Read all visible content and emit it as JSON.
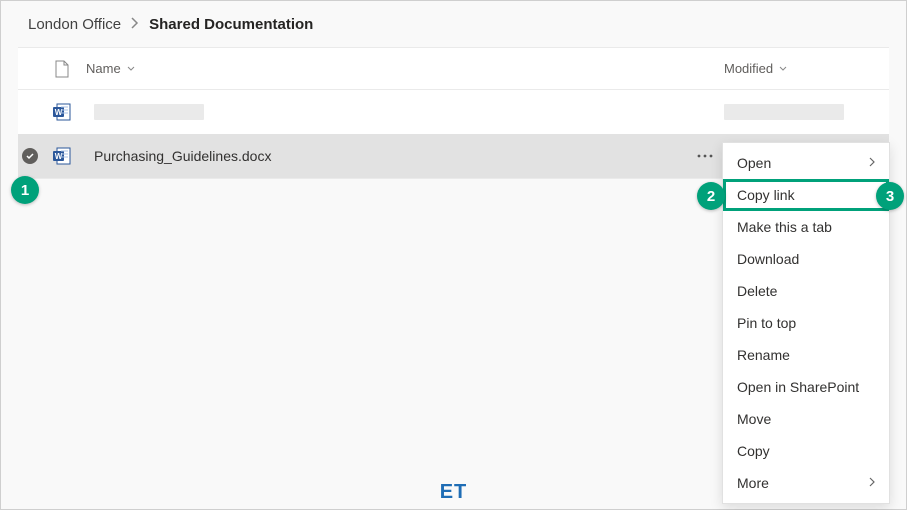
{
  "breadcrumb": {
    "parent": "London Office",
    "current": "Shared Documentation"
  },
  "columns": {
    "name": "Name",
    "modified": "Modified"
  },
  "rows": [
    {
      "name": "",
      "selected": false,
      "redacted": true
    },
    {
      "name": "Purchasing_Guidelines.docx",
      "selected": true,
      "redacted": false
    }
  ],
  "menu": {
    "items": [
      {
        "label": "Open",
        "submenu": true,
        "highlighted": false
      },
      {
        "label": "Copy link",
        "submenu": false,
        "highlighted": true
      },
      {
        "label": "Make this a tab",
        "submenu": false,
        "highlighted": false
      },
      {
        "label": "Download",
        "submenu": false,
        "highlighted": false
      },
      {
        "label": "Delete",
        "submenu": false,
        "highlighted": false
      },
      {
        "label": "Pin to top",
        "submenu": false,
        "highlighted": false
      },
      {
        "label": "Rename",
        "submenu": false,
        "highlighted": false
      },
      {
        "label": "Open in SharePoint",
        "submenu": false,
        "highlighted": false
      },
      {
        "label": "Move",
        "submenu": false,
        "highlighted": false
      },
      {
        "label": "Copy",
        "submenu": false,
        "highlighted": false
      },
      {
        "label": "More",
        "submenu": true,
        "highlighted": false
      }
    ]
  },
  "badges": {
    "b1": "1",
    "b2": "2",
    "b3": "3"
  },
  "watermark": "ET"
}
